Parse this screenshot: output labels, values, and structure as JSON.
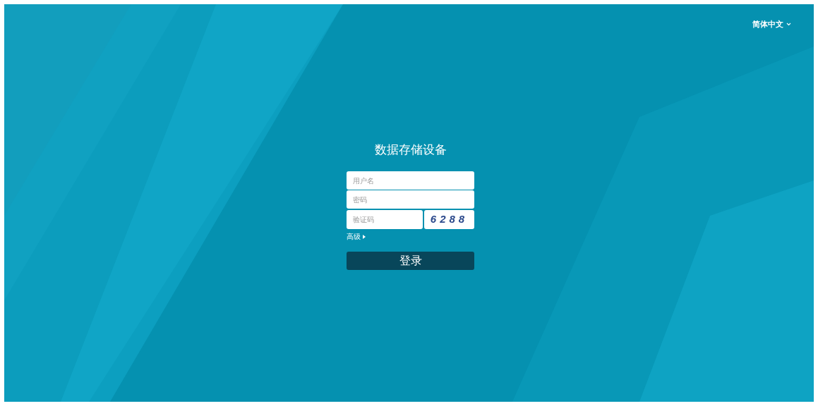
{
  "language_selector": {
    "label": "简体中文"
  },
  "login": {
    "title": "数据存储设备",
    "username": {
      "placeholder": "用户名"
    },
    "password": {
      "placeholder": "密码"
    },
    "captcha": {
      "placeholder": "验证码",
      "code": "6288"
    },
    "advanced": {
      "label": "高级",
      "expanded": false
    },
    "submit": "登录"
  }
}
